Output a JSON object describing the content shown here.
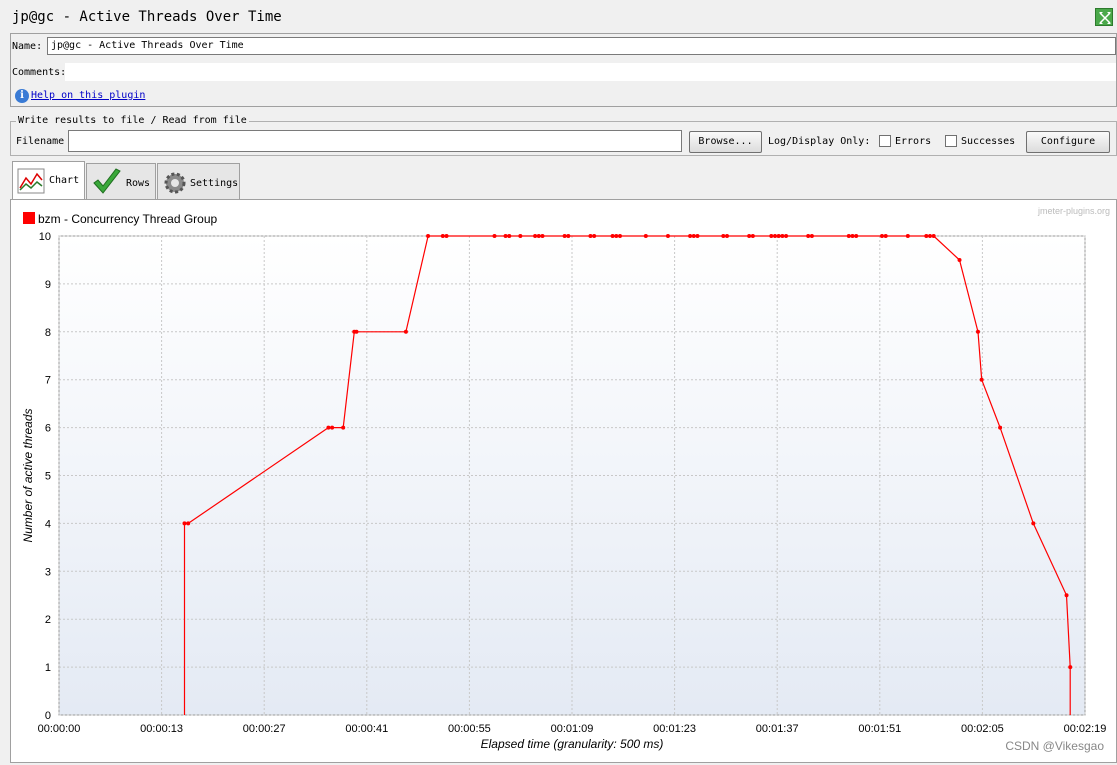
{
  "window": {
    "title": "jp@gc - Active Threads Over Time"
  },
  "form": {
    "name_label": "Name:",
    "name_value": "jp@gc - Active Threads Over Time",
    "comments_label": "Comments:",
    "help_link": "Help on this plugin"
  },
  "file": {
    "legend": "Write results to file / Read from file",
    "filename_label": "Filename",
    "filename_value": "",
    "browse_button": "Browse...",
    "log_display_label": "Log/Display Only:",
    "errors_label": "Errors",
    "successes_label": "Successes",
    "configure_button": "Configure"
  },
  "tabs": [
    {
      "label": "Chart",
      "icon": "chart-icon"
    },
    {
      "label": "Rows",
      "icon": "checkmark-icon"
    },
    {
      "label": "Settings",
      "icon": "gear-icon"
    }
  ],
  "colors": {
    "series": "#ff0000",
    "grid": "#c8c8c8",
    "legend_box": "#ff0000"
  },
  "watermark": "jmeter-plugins.org",
  "credit": "CSDN @Vikesgao",
  "chart_data": {
    "type": "line",
    "legend": [
      {
        "name": "bzm - Concurrency Thread Group",
        "color": "#ff0000"
      }
    ],
    "xlabel": "Elapsed time (granularity: 500 ms)",
    "ylabel": "Number of active threads",
    "ylim": [
      0,
      10
    ],
    "xlim_seconds": [
      0,
      139
    ],
    "y_ticks": [
      "0",
      "1",
      "2",
      "3",
      "4",
      "5",
      "6",
      "7",
      "8",
      "9",
      "10"
    ],
    "x_ticks": [
      "00:00:00",
      "00:00:13",
      "00:00:27",
      "00:00:41",
      "00:00:55",
      "00:01:09",
      "00:01:23",
      "00:01:37",
      "00:01:51",
      "00:02:05",
      "00:02:19"
    ],
    "grid": true,
    "legend_position": "top-left",
    "series": [
      {
        "name": "bzm - Concurrency Thread Group",
        "points_seconds": [
          [
            17,
            0
          ],
          [
            17,
            4
          ],
          [
            17.5,
            4
          ],
          [
            36.5,
            6
          ],
          [
            37,
            6
          ],
          [
            38.5,
            6
          ],
          [
            40,
            8
          ],
          [
            40.3,
            8
          ],
          [
            47,
            8
          ],
          [
            50,
            10
          ],
          [
            52,
            10
          ],
          [
            52.5,
            10
          ],
          [
            59,
            10
          ],
          [
            60.5,
            10
          ],
          [
            61,
            10
          ],
          [
            62.5,
            10
          ],
          [
            64.5,
            10
          ],
          [
            65,
            10
          ],
          [
            65.5,
            10
          ],
          [
            68.5,
            10
          ],
          [
            69,
            10
          ],
          [
            72,
            10
          ],
          [
            72.5,
            10
          ],
          [
            75,
            10
          ],
          [
            75.5,
            10
          ],
          [
            76,
            10
          ],
          [
            79.5,
            10
          ],
          [
            82.5,
            10
          ],
          [
            85.5,
            10
          ],
          [
            86,
            10
          ],
          [
            86.5,
            10
          ],
          [
            90,
            10
          ],
          [
            90.5,
            10
          ],
          [
            93.5,
            10
          ],
          [
            94,
            10
          ],
          [
            96.5,
            10
          ],
          [
            97,
            10
          ],
          [
            97.5,
            10
          ],
          [
            98,
            10
          ],
          [
            98.5,
            10
          ],
          [
            101.5,
            10
          ],
          [
            102,
            10
          ],
          [
            107,
            10
          ],
          [
            107.5,
            10
          ],
          [
            108,
            10
          ],
          [
            111.5,
            10
          ],
          [
            112,
            10
          ],
          [
            115,
            10
          ],
          [
            117.5,
            10
          ],
          [
            118,
            10
          ],
          [
            118.5,
            10
          ],
          [
            122,
            9.5
          ],
          [
            124.5,
            8
          ],
          [
            125,
            7
          ],
          [
            127.5,
            6
          ],
          [
            132,
            4
          ],
          [
            136.5,
            2.5
          ],
          [
            137,
            1
          ],
          [
            137,
            0
          ]
        ]
      }
    ]
  }
}
